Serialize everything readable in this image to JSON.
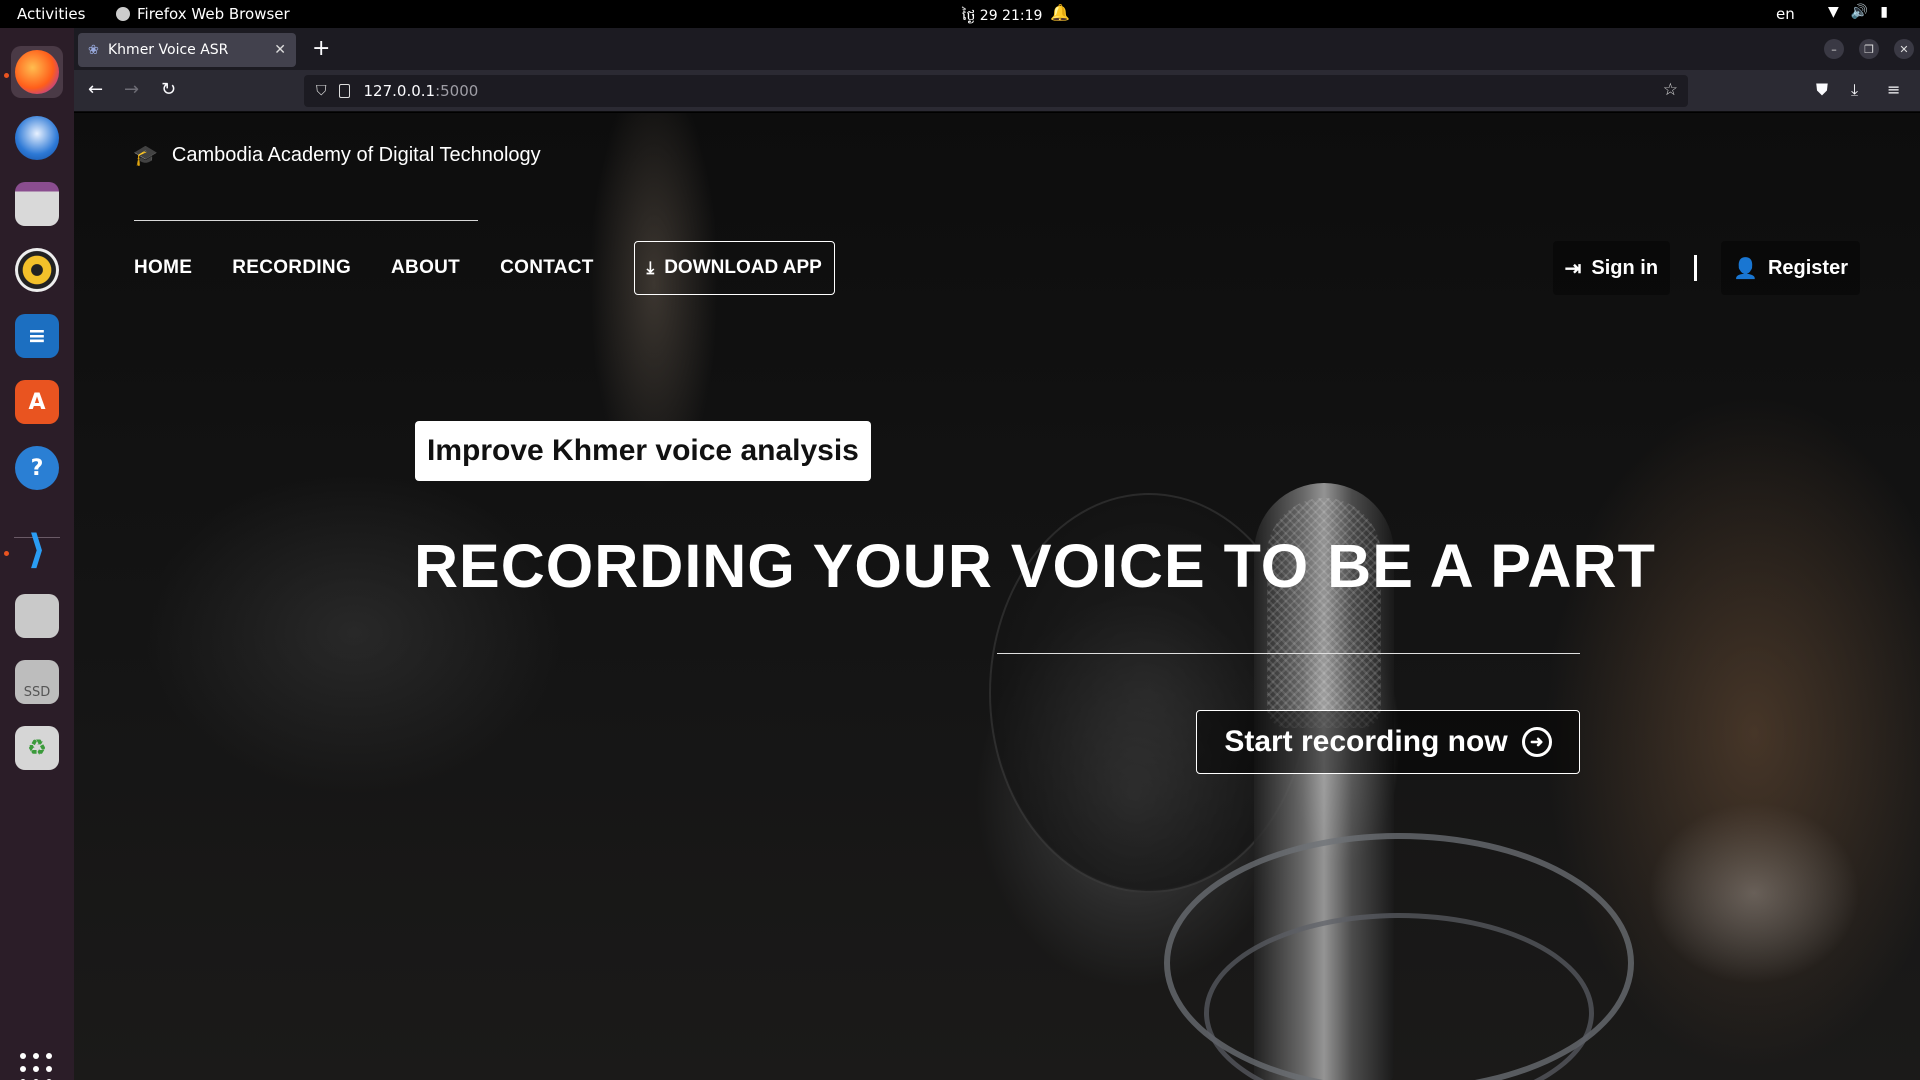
{
  "system": {
    "activities": "Activities",
    "app_name": "Firefox Web Browser",
    "clock": "ថ្ងៃ 29  21:19",
    "language": "en"
  },
  "browser": {
    "tab_title": "Khmer Voice ASR",
    "url_host": "127.0.0.1",
    "url_port": ":5000"
  },
  "site": {
    "brand": "Cambodia Academy of Digital Technology",
    "nav": [
      "HOME",
      "RECORDING",
      "ABOUT",
      "CONTACT"
    ],
    "download_label": "DOWNLOAD APP",
    "signin_label": "Sign in",
    "register_label": "Register"
  },
  "hero": {
    "tagline": "Improve Khmer voice analysis",
    "headline": "RECORDING YOUR VOICE TO BE A PART",
    "cta_label": "Start recording now"
  },
  "dock": {
    "items": [
      "firefox-icon",
      "thunderbird-icon",
      "files-icon",
      "rhythmbox-icon",
      "writer-icon",
      "software-icon",
      "help-icon",
      "vscode-icon",
      "disk-icon",
      "ssd-icon",
      "trash-icon"
    ],
    "ssd_label": "SSD"
  }
}
